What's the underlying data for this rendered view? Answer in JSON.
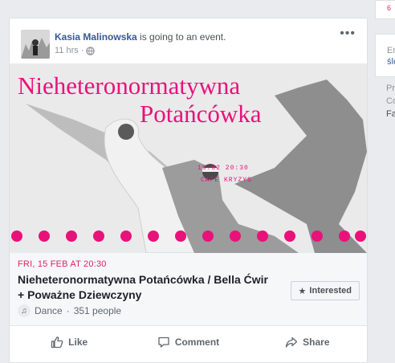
{
  "post": {
    "author": "Kasia Malinowska",
    "verb": " is going to an event.",
    "time": "11 hrs",
    "dot": "·",
    "more_label": "•••"
  },
  "event": {
    "image_title_line1": "Nieheteronormatywna",
    "image_title_line2": "Potańcówka",
    "image_date": "15.02 20:30",
    "image_venue": "CAFE KRYZYS",
    "date": "FRI, 15 FEB AT 20:30",
    "title": "Nieheteronormatywna Potańcówka / Bella Ćwir + Poważne Dziewczyny",
    "category": "Dance",
    "sep": "·",
    "going_count": "351 people",
    "interested_label": "Interested",
    "music_glyph": "♫",
    "star_glyph": "★"
  },
  "actions": {
    "like": "Like",
    "comment": "Comment",
    "share": "Share"
  },
  "right_column": {
    "cal_text": "6",
    "line_er": "Er",
    "line_slo": "ślo",
    "line_pr": "Pr",
    "line_co": "Co",
    "line_fa": "Fa"
  },
  "colors": {
    "accent_pink": "#e0245e",
    "link_blue": "#365899",
    "poster_pink": "#e8127a"
  }
}
